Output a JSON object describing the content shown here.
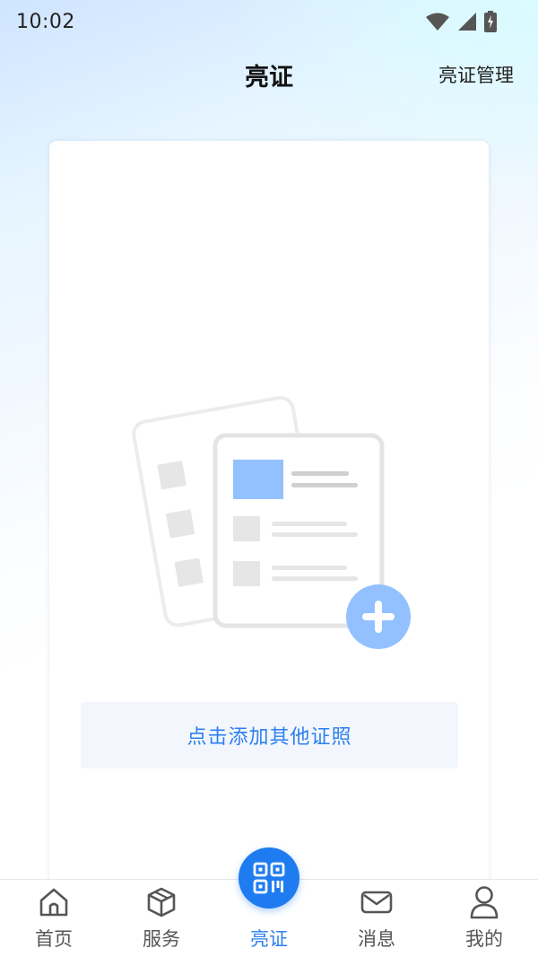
{
  "status_bar": {
    "time": "10:02",
    "icons": [
      "wifi-icon",
      "signal-icon",
      "battery-icon"
    ]
  },
  "header": {
    "title": "亮证",
    "action_label": "亮证管理"
  },
  "card": {
    "illustration_icon": "add-license-illustration",
    "add_button_label": "点击添加其他证照"
  },
  "tab_bar": {
    "items": [
      {
        "label": "首页",
        "icon": "home-icon",
        "active": false
      },
      {
        "label": "服务",
        "icon": "cube-icon",
        "active": false
      },
      {
        "label": "亮证",
        "icon": "qr-code-icon",
        "active": true
      },
      {
        "label": "消息",
        "icon": "mail-icon",
        "active": false
      },
      {
        "label": "我的",
        "icon": "user-icon",
        "active": false
      }
    ]
  },
  "colors": {
    "accent": "#2d7ff0",
    "fab": "#1f7cf0",
    "illustration_blue": "#93c1ff",
    "button_bg": "#f3f7fd"
  }
}
